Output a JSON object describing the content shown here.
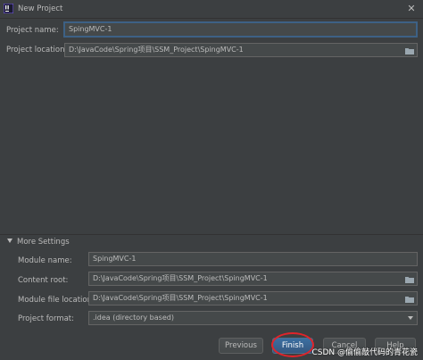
{
  "window": {
    "title": "New Project"
  },
  "top_form": {
    "project_name_label": "Project name:",
    "project_name_value": "SpingMVC-1",
    "project_location_label": "Project location:",
    "project_location_value": "D:\\JavaCode\\Spring项目\\SSM_Project\\SpingMVC-1"
  },
  "more_settings": {
    "header": "More Settings",
    "module_name_label": "Module name:",
    "module_name_value": "SpingMVC-1",
    "content_root_label": "Content root:",
    "content_root_value": "D:\\JavaCode\\Spring项目\\SSM_Project\\SpingMVC-1",
    "module_file_location_label": "Module file location:",
    "module_file_location_value": "D:\\JavaCode\\Spring项目\\SSM_Project\\SpingMVC-1",
    "project_format_label": "Project format:",
    "project_format_value": ".idea (directory based)"
  },
  "buttons": {
    "previous": "Previous",
    "finish": "Finish",
    "cancel": "Cancel",
    "help": "Help"
  },
  "watermark": "CSDN @偷偷敲代码的青花瓷",
  "icons": {
    "app": "intellij-idea-icon",
    "close": "close-icon",
    "folder": "folder-icon",
    "disclosure": "triangle-down-icon",
    "dropdown": "chevron-down-icon"
  },
  "colors": {
    "background": "#3c3f41",
    "field_bg": "#45494a",
    "focus_border": "#3d6185",
    "primary_button": "#365880",
    "annotation": "#e0242a"
  }
}
